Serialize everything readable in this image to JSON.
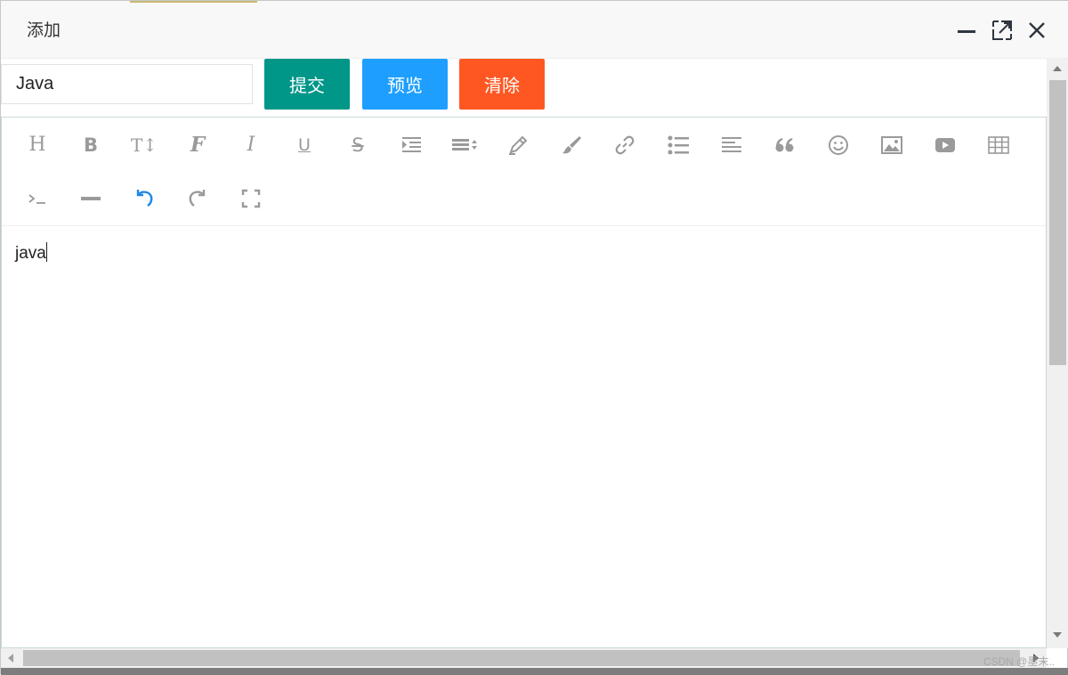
{
  "dialog": {
    "title": "添加",
    "window_buttons": [
      "minimize-icon",
      "maximize-icon",
      "close-icon"
    ]
  },
  "form": {
    "title_value": "Java",
    "submit_label": "提交",
    "preview_label": "预览",
    "clear_label": "清除",
    "colors": {
      "submit": "#009688",
      "preview": "#1e9fff",
      "clear": "#ff5722"
    }
  },
  "editor": {
    "toolbar": {
      "heading": "H",
      "bold": "B",
      "text_size": "T↕",
      "font": "F",
      "italic": "I",
      "underline": "U",
      "strikethrough": "S",
      "icons": [
        "heading-icon",
        "bold-icon",
        "text-size-icon",
        "font-family-icon",
        "italic-icon",
        "underline-icon",
        "strikethrough-icon",
        "indent-icon",
        "line-height-icon",
        "font-color-icon",
        "background-color-icon",
        "link-icon",
        "list-icon",
        "align-icon",
        "quote-icon",
        "emoji-icon",
        "image-icon",
        "video-icon",
        "table-icon",
        "code-icon",
        "divider-icon",
        "undo-icon",
        "redo-icon",
        "fullscreen-icon"
      ]
    },
    "content": "java"
  },
  "watermark": "CSDN @墨末.."
}
